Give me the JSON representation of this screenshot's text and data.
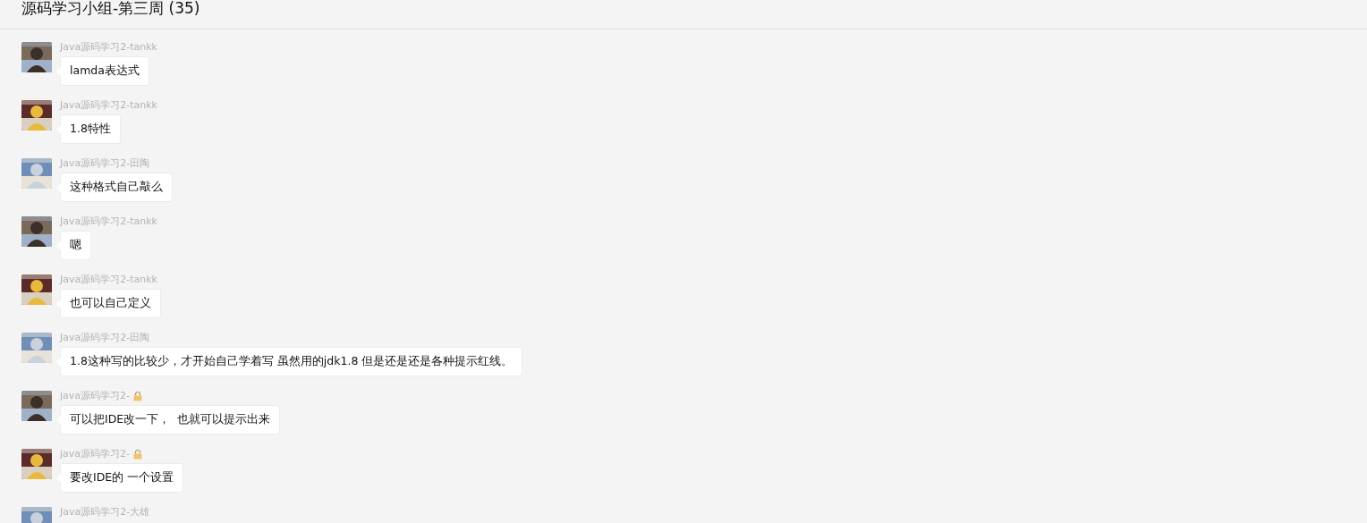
{
  "header": {
    "title": "源码学习小组-第三周 (35)"
  },
  "messages": [
    {
      "sender": "Java源码学习2-tankk",
      "locked": false,
      "text": "lamda表达式"
    },
    {
      "sender": "Java源码学习2-tankk",
      "locked": false,
      "text": "1.8特性"
    },
    {
      "sender": "Java源码学习2-田陶",
      "locked": false,
      "text": "这种格式自己敲么"
    },
    {
      "sender": "Java源码学习2-tankk",
      "locked": false,
      "text": "嗯"
    },
    {
      "sender": "Java源码学习2-tankk",
      "locked": false,
      "text": "也可以自己定义"
    },
    {
      "sender": "Java源码学习2-田陶",
      "locked": false,
      "text": "1.8这种写的比较少，才开始自己学着写 虽然用的jdk1.8 但是还是还是各种提示红线。"
    },
    {
      "sender": "java源码学习2-",
      "locked": true,
      "text": "可以把IDE改一下，  也就可以提示出来"
    },
    {
      "sender": "java源码学习2-",
      "locked": true,
      "text": "要改IDE的 一个设置"
    },
    {
      "sender": "Java源码学习2-大雄",
      "locked": false
    }
  ]
}
